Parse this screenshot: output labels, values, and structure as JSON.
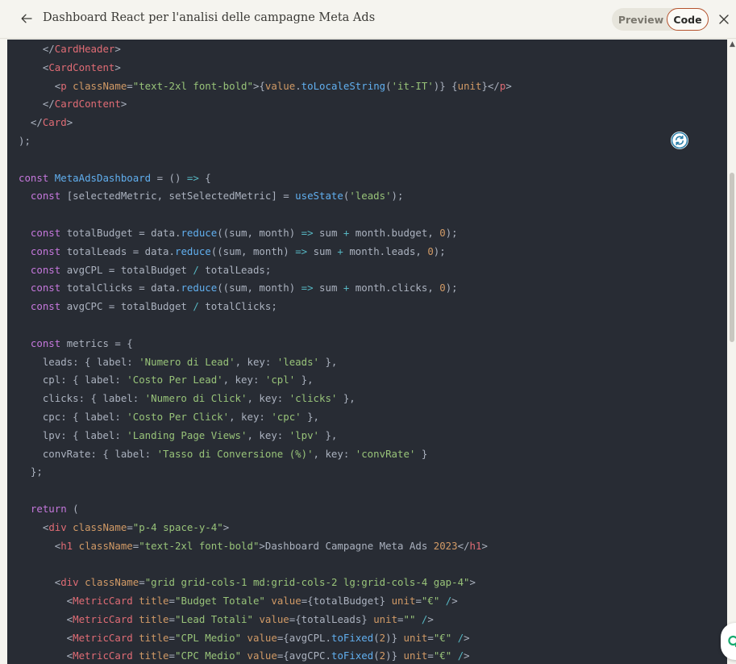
{
  "header": {
    "title": "Dashboard React per l'analisi delle campagne Meta Ads",
    "preview_label": "Preview",
    "code_label": "Code"
  },
  "icons": {
    "back": "arrow-left-icon",
    "close": "close-icon",
    "sync": "sync-icon",
    "fab": "grammarly-icon"
  },
  "colors": {
    "background": "#f5f4ef",
    "code_background": "#282c34",
    "accent": "#b5532e",
    "keyword": "#c678dd",
    "function": "#61afef",
    "string": "#98c379",
    "tag": "#e06c75",
    "number": "#d19a66"
  },
  "code": {
    "lines": [
      "    </CardHeader>",
      "    <CardContent>",
      "      <p className=\"text-2xl font-bold\">{value.toLocaleString('it-IT')} {unit}</p>",
      "    </CardContent>",
      "  </Card>",
      ");",
      "",
      "const MetaAdsDashboard = () => {",
      "  const [selectedMetric, setSelectedMetric] = useState('leads');",
      "",
      "  const totalBudget = data.reduce((sum, month) => sum + month.budget, 0);",
      "  const totalLeads = data.reduce((sum, month) => sum + month.leads, 0);",
      "  const avgCPL = totalBudget / totalLeads;",
      "  const totalClicks = data.reduce((sum, month) => sum + month.clicks, 0);",
      "  const avgCPC = totalBudget / totalClicks;",
      "",
      "  const metrics = {",
      "    leads: { label: 'Numero di Lead', key: 'leads' },",
      "    cpl: { label: 'Costo Per Lead', key: 'cpl' },",
      "    clicks: { label: 'Numero di Click', key: 'clicks' },",
      "    cpc: { label: 'Costo Per Click', key: 'cpc' },",
      "    lpv: { label: 'Landing Page Views', key: 'lpv' },",
      "    convRate: { label: 'Tasso di Conversione (%)', key: 'convRate' }",
      "  };",
      "",
      "  return (",
      "    <div className=\"p-4 space-y-4\">",
      "      <h1 className=\"text-2xl font-bold\">Dashboard Campagne Meta Ads 2023</h1>",
      "",
      "      <div className=\"grid grid-cols-1 md:grid-cols-2 lg:grid-cols-4 gap-4\">",
      "        <MetricCard title=\"Budget Totale\" value={totalBudget} unit=\"€\" />",
      "        <MetricCard title=\"Lead Totali\" value={totalLeads} unit=\"\" />",
      "        <MetricCard title=\"CPL Medio\" value={avgCPL.toFixed(2)} unit=\"€\" />",
      "        <MetricCard title=\"CPC Medio\" value={avgCPC.toFixed(2)} unit=\"€\" />"
    ]
  }
}
